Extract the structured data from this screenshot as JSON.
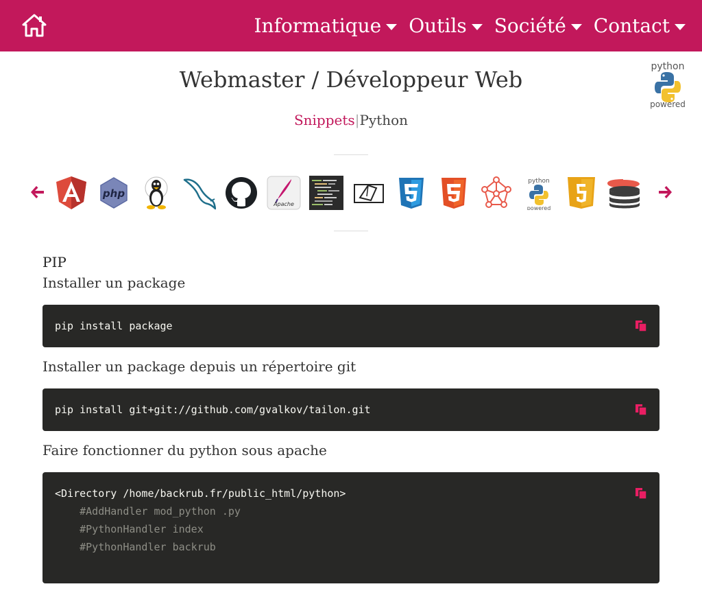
{
  "nav": {
    "menu": [
      {
        "label": "Informatique"
      },
      {
        "label": "Outils"
      },
      {
        "label": "Société"
      },
      {
        "label": "Contact"
      }
    ],
    "brand_color": "#c2185b"
  },
  "header": {
    "title": "Webmaster / Développeur Web",
    "badge": {
      "top": "python",
      "bottom": "powered"
    }
  },
  "breadcrumb": {
    "link": "Snippets",
    "separator": "|",
    "current": "Python"
  },
  "carousel": {
    "icons": [
      "angular-icon",
      "php-icon",
      "linux-icon",
      "mysql-icon",
      "github-icon",
      "apache-icon",
      "code-editor-icon",
      "drupal-icon",
      "css3-icon",
      "html5-icon",
      "network-icon",
      "python-icon",
      "js-icon",
      "database-icon"
    ],
    "python_badge": {
      "top": "python",
      "bottom": "powered"
    },
    "php_label": "php",
    "apache_label": "Apache"
  },
  "main": {
    "section_title": "PIP",
    "snippets": [
      {
        "description": "Installer un package",
        "code": [
          "pip install package"
        ]
      },
      {
        "description": "Installer un package depuis un répertoire git",
        "code": [
          "pip install git+git://github.com/gvalkov/tailon.git"
        ]
      },
      {
        "description": "Faire fonctionner du python sous apache",
        "code": [
          "<Directory /home/backrub.fr/public_html/python>"
        ],
        "comments": [
          "    #AddHandler mod_python .py",
          "    #PythonHandler index",
          "    #PythonHandler backrub"
        ]
      }
    ]
  }
}
